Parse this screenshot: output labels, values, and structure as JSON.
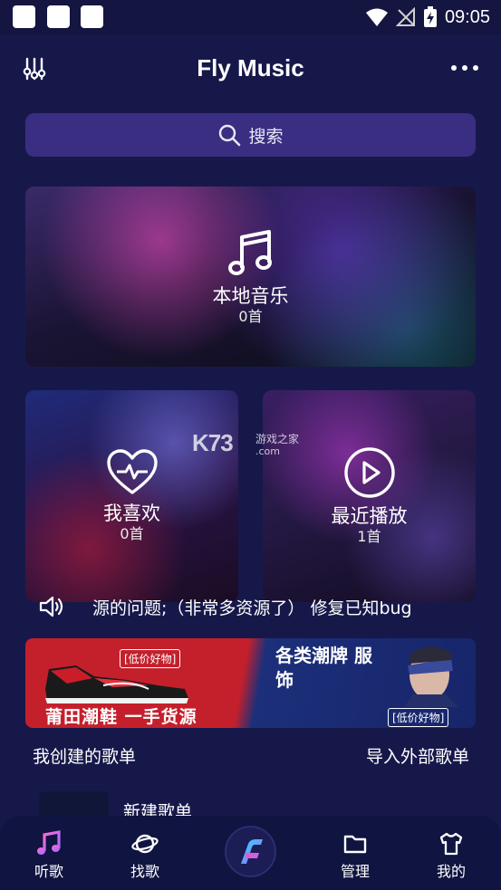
{
  "status_bar": {
    "time": "09:05"
  },
  "header": {
    "title": "Fly Music",
    "left_icon": "equalizer-icon",
    "right_icon": "more-icon"
  },
  "search": {
    "label": "搜索",
    "icon": "search-icon"
  },
  "cards": {
    "local": {
      "title": "本地音乐",
      "count": "0首",
      "icon": "music-note-icon"
    },
    "favorites": {
      "title": "我喜欢",
      "count": "0首",
      "icon": "heart-pulse-icon"
    },
    "recent": {
      "title": "最近播放",
      "count": "1首",
      "icon": "play-circle-icon"
    }
  },
  "watermark": {
    "big": "K73",
    "small": "游戏之家",
    "domain": ".com"
  },
  "notice": {
    "icon": "speaker-icon",
    "text": "源的问题;（非常多资源了） 修复已知bug"
  },
  "banner": {
    "tag_left": "[低价好物]",
    "main_left": "莆田潮鞋 一手货源",
    "main_right": "各类潮牌 服饰",
    "tag_right": "[低价好物]"
  },
  "playlists": {
    "my_created": "我创建的歌单",
    "import_external": "导入外部歌单",
    "items": [
      {
        "name": "新建歌单"
      }
    ]
  },
  "bottom_nav": {
    "items": [
      {
        "label": "听歌",
        "icon": "music-note-icon"
      },
      {
        "label": "找歌",
        "icon": "planet-icon"
      },
      {
        "label": "管理",
        "icon": "folder-icon"
      },
      {
        "label": "我的",
        "icon": "tshirt-icon"
      }
    ],
    "center_icon": "fly-logo-icon"
  },
  "colors": {
    "background": "#17184a",
    "search_bg": "#3a2e82",
    "nav_bg": "#0f1440",
    "accent_purple": "#b06cff",
    "accent_cyan": "#35d3ff",
    "accent_pink": "#ff4fb0"
  }
}
